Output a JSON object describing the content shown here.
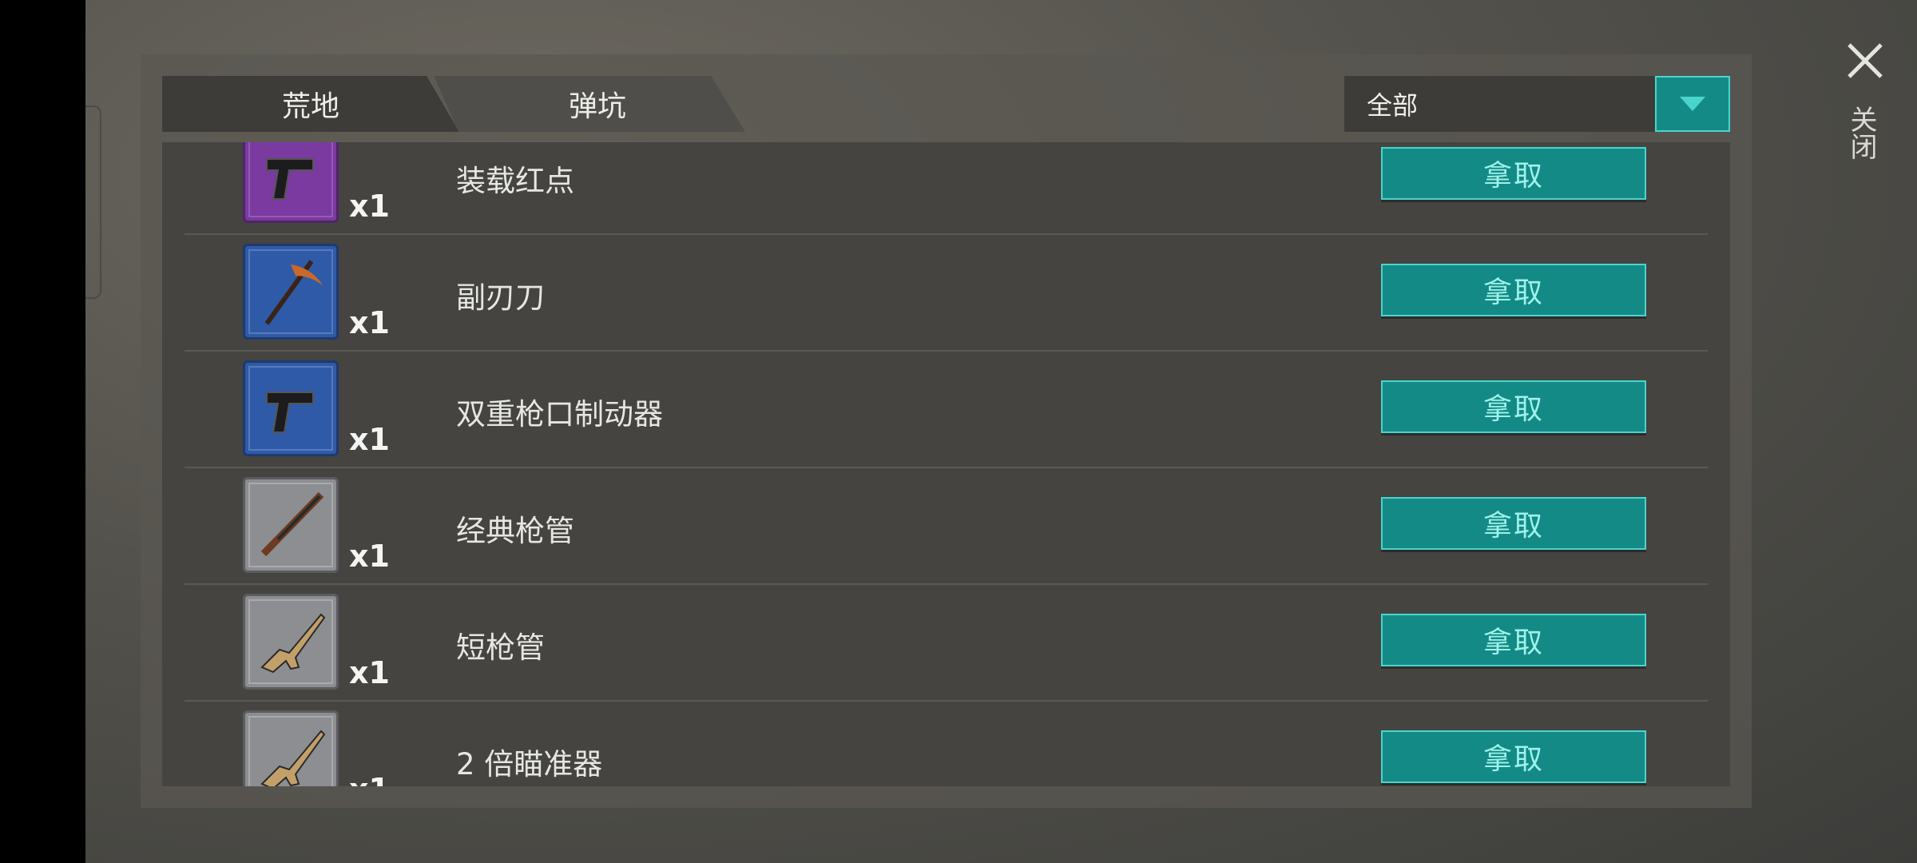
{
  "tabs": [
    {
      "label": "荒地",
      "active": true
    },
    {
      "label": "弹坑",
      "active": false
    }
  ],
  "filter": {
    "selected": "全部",
    "dropdown_icon": "chevron-down-icon"
  },
  "close": {
    "icon": "close-icon",
    "label": "关闭"
  },
  "items": [
    {
      "name": "装载红点",
      "qty": "x1",
      "rarity": "purple",
      "icon": "pistol-icon",
      "action": "拿取"
    },
    {
      "name": "副刃刀",
      "qty": "x1",
      "rarity": "blue",
      "icon": "pickaxe-icon",
      "action": "拿取"
    },
    {
      "name": "双重枪口制动器",
      "qty": "x1",
      "rarity": "blue",
      "icon": "pistol-icon",
      "action": "拿取"
    },
    {
      "name": "经典枪管",
      "qty": "x1",
      "rarity": "gray",
      "icon": "shotgun-icon",
      "action": "拿取"
    },
    {
      "name": "短枪管",
      "qty": "x1",
      "rarity": "gray",
      "icon": "rifle-icon",
      "action": "拿取"
    },
    {
      "name": "2 倍瞄准器",
      "qty": "x1",
      "rarity": "gray",
      "icon": "rifle-icon",
      "action": "拿取"
    }
  ],
  "colors": {
    "accent": "#148a86",
    "accent_border": "#49d5cd",
    "rarity_purple": "#7a3aa0",
    "rarity_blue": "#2f5aa8",
    "rarity_gray": "#8c8e92"
  }
}
